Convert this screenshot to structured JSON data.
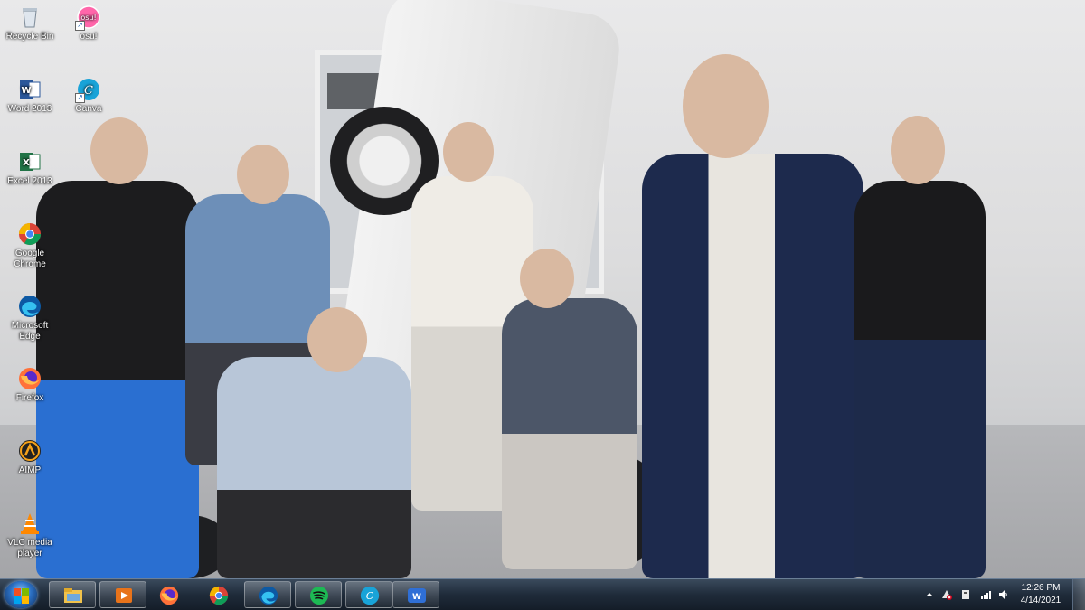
{
  "desktop": {
    "icons": [
      {
        "label": "Recycle Bin",
        "icon": "recycle-bin-icon"
      },
      {
        "label": "osu!",
        "icon": "osu-icon"
      },
      {
        "label": "Word 2013",
        "icon": "word-icon"
      },
      {
        "label": "Canva",
        "icon": "canva-icon"
      },
      {
        "label": "Excel 2013",
        "icon": "excel-icon"
      },
      {
        "label": "Google Chrome",
        "icon": "chrome-icon"
      },
      {
        "label": "Microsoft Edge",
        "icon": "edge-icon"
      },
      {
        "label": "Firefox",
        "icon": "firefox-icon"
      },
      {
        "label": "AIMP",
        "icon": "aimp-icon"
      },
      {
        "label": "VLC media player",
        "icon": "vlc-icon"
      }
    ]
  },
  "taskbar": {
    "pinned": [
      {
        "icon": "file-explorer-icon"
      },
      {
        "icon": "media-player-icon"
      },
      {
        "icon": "firefox-icon"
      },
      {
        "icon": "chrome-icon"
      },
      {
        "icon": "edge-icon"
      },
      {
        "icon": "spotify-icon"
      },
      {
        "icon": "canva-icon"
      },
      {
        "icon": "wps-office-icon"
      }
    ],
    "clock": {
      "time": "12:26 PM",
      "date": "4/14/2021"
    }
  },
  "colors": {
    "taskbar": "#1f2b3a",
    "accent": "#2b6fc2"
  }
}
